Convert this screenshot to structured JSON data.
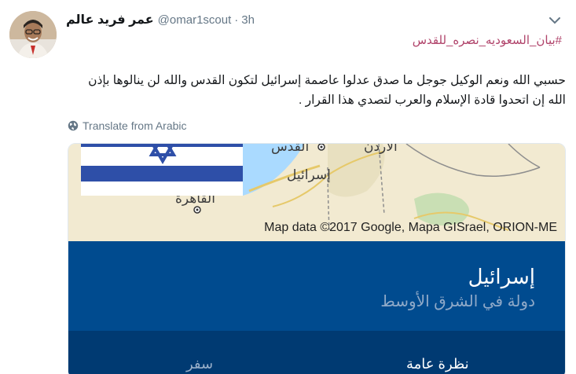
{
  "tweet": {
    "display_name": "عمر فريد عالم",
    "handle": "@omar1scout",
    "separator": "·",
    "time": "3h",
    "hashtag": "#بيان_السعوديه_نصره_للقدس",
    "text": "حسبي الله ونعم الوكيل جوجل ما صدق عدلوا عاصمة إسرائيل لتكون القدس والله لن ينالوها بإذن الله إن اتحدوا قادة الإسلام والعرب لتصدي هذا القرار .",
    "translate_label": "Translate from Arabic"
  },
  "card": {
    "map": {
      "labels": {
        "jerusalem": "القدس",
        "jordan": "الأردن",
        "israel": "إسرائيل",
        "cairo": "القاهرة"
      },
      "attribution": "Map data ©2017 Google, Mapa GISrael, ORION-ME"
    },
    "place_title": "إسرائيل",
    "place_subtitle": "دولة في الشرق الأوسط",
    "tabs": [
      {
        "label": "نظرة عامة",
        "active": true
      },
      {
        "label": "سفر",
        "active": false
      }
    ]
  },
  "colors": {
    "hashtag": "#b0436a",
    "panel": "#004b8f",
    "tabs_bar": "#003a72",
    "flag_blue": "#2e4fa8"
  },
  "icons": [
    "chevron-down-icon",
    "globe-icon",
    "star-of-david-icon",
    "city-marker-icon"
  ]
}
